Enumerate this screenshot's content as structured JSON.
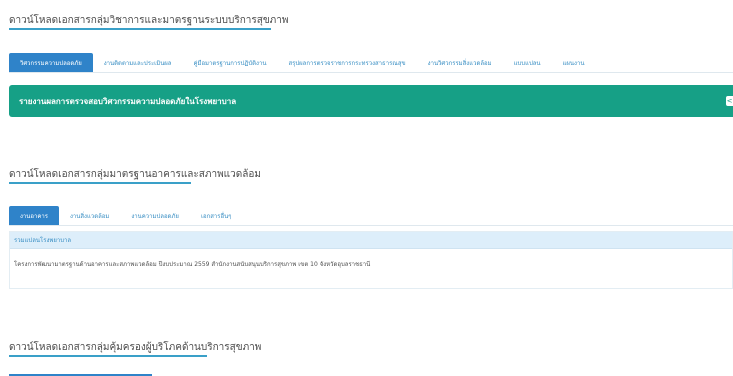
{
  "sections": [
    {
      "title": "ดาวน์โหลดเอกสารกลุ่มวิชาการและมาตรฐานระบบบริการสุขภาพ",
      "tabs": [
        "วิศวกรรมความปลอดภัย",
        "งานติดตามและประเมินผล",
        "คู่มือมาตรฐานการปฏิบัติงาน",
        "สรุปผลการตรวจราชการกระทรวงสาธารณสุข",
        "งานวิศวกรรมสิ่งแวดล้อม",
        "แบบแปลน",
        "แผนงาน"
      ],
      "active_tab": 0,
      "banner_text": "รายงานผลการตรวจสอบวิศวกรรมความปลอดภัยในโรงพยาบาล",
      "banner_toggle": "<"
    },
    {
      "title": "ดาวน์โหลดเอกสารกลุ่มมาตรฐานอาคารและสภาพแวดล้อม",
      "tabs": [
        "งานอาคาร",
        "งานสิ่งแวดล้อม",
        "งานความปลอดภัย",
        "เอกสารอื่นๆ"
      ],
      "active_tab": 0,
      "panel_header": "รวมแปลนโรงพยาบาล",
      "panel_row": "โครงการพัฒนามาตรฐานด้านอาคารและสภาพแวดล้อม ปีงบประมาณ 2559 สำนักงานสนับสนุนบริการสุขภาพ เขต 10 จังหวัดอุบลราชธานี"
    },
    {
      "title": "ดาวน์โหลดเอกสารกลุ่มคุ้มครองผู้บริโภคด้านบริการสุขภาพ"
    }
  ],
  "colors": {
    "accent_blue": "#2f83c9",
    "link_blue": "#3a8fc4",
    "banner_green": "#16a086",
    "panel_header_bg": "#ddeefa"
  }
}
